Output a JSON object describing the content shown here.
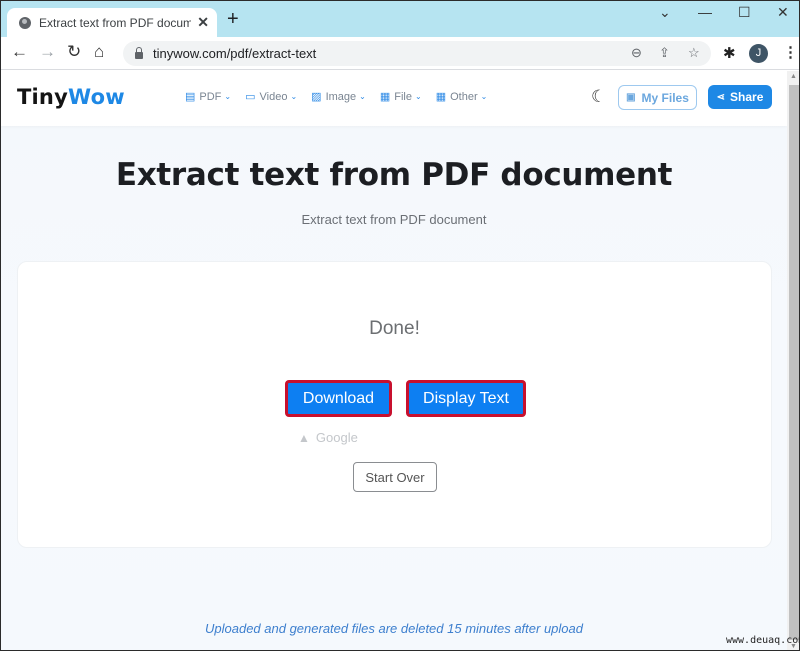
{
  "browser": {
    "tab_title": "Extract text from PDF document",
    "tab_close": "✕",
    "new_tab": "+",
    "window_controls": {
      "dropdown": "⌄",
      "minimize": "—",
      "maximize": "☐",
      "close": "✕"
    },
    "nav": {
      "back": "←",
      "forward": "→",
      "reload": "↻",
      "home": "⌂"
    },
    "url": "tinywow.com/pdf/extract-text",
    "omni_icons": {
      "zoom": "⊖",
      "share": "⇪",
      "bookmark": "☆"
    },
    "extensions_icon": "✱",
    "profile_initial": "J",
    "menu_icon": "⋮"
  },
  "site": {
    "logo_part1": "Tiny",
    "logo_part2": "Wow",
    "nav": [
      {
        "label": "PDF",
        "icon": "▤"
      },
      {
        "label": "Video",
        "icon": "▭"
      },
      {
        "label": "Image",
        "icon": "▨"
      },
      {
        "label": "File",
        "icon": "▦"
      },
      {
        "label": "Other",
        "icon": "▦"
      }
    ],
    "chevron": "⌄",
    "dark_mode_icon": "☾",
    "my_files_label": "My Files",
    "my_files_icon": "▣",
    "share_label": "Share",
    "share_icon": "⋖"
  },
  "main": {
    "title": "Extract text from PDF document",
    "subtitle": "Extract text from PDF document",
    "status": "Done!",
    "download_label": "Download",
    "display_text_label": "Display Text",
    "google_label": "Google",
    "google_icon": "▲",
    "start_over_label": "Start Over",
    "notice": "Uploaded and generated files are deleted 15 minutes after upload"
  },
  "watermark": "www.deuaq.com"
}
